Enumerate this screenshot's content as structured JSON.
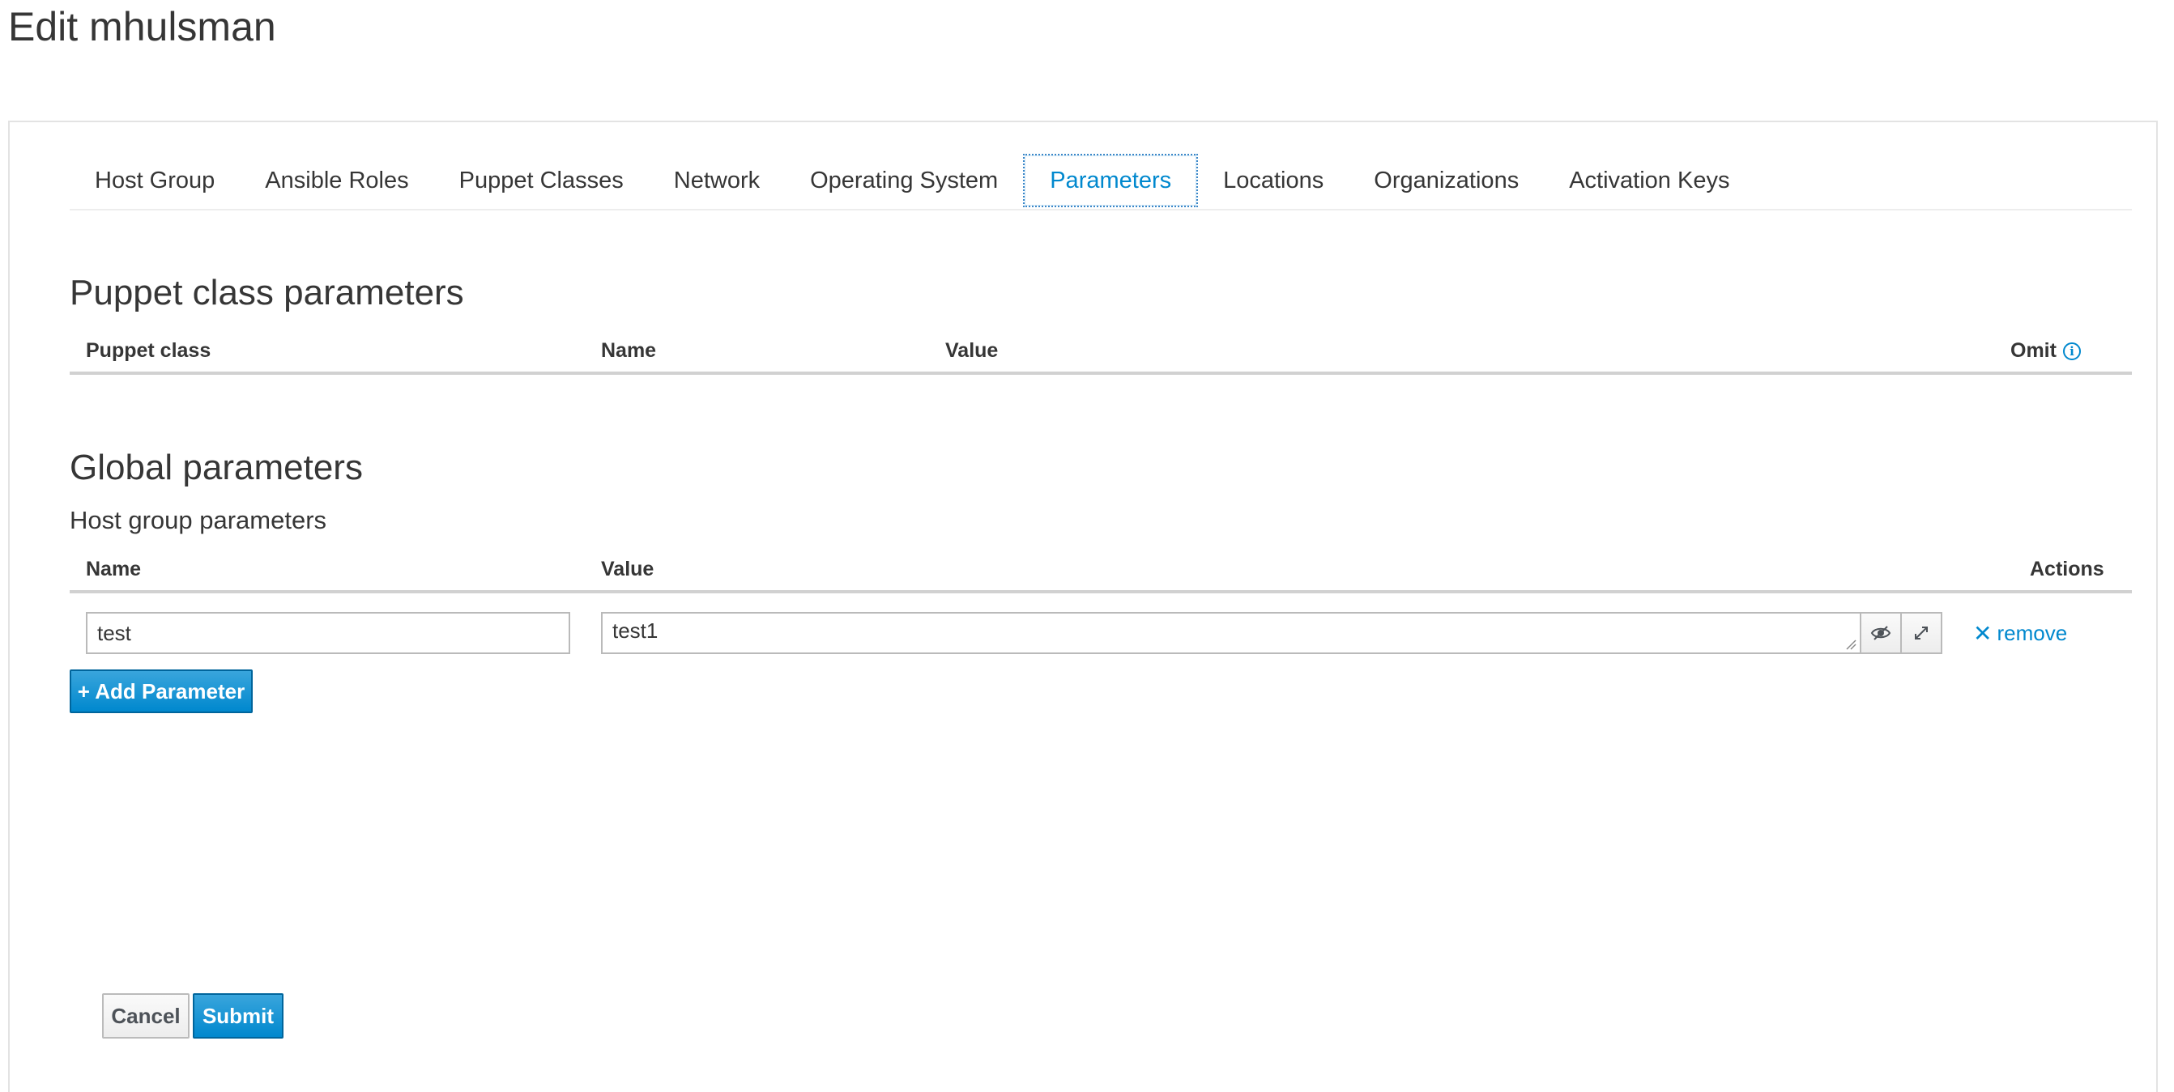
{
  "page": {
    "title": "Edit mhulsman"
  },
  "tabs": [
    {
      "label": "Host Group",
      "active": false
    },
    {
      "label": "Ansible Roles",
      "active": false
    },
    {
      "label": "Puppet Classes",
      "active": false
    },
    {
      "label": "Network",
      "active": false
    },
    {
      "label": "Operating System",
      "active": false
    },
    {
      "label": "Parameters",
      "active": true
    },
    {
      "label": "Locations",
      "active": false
    },
    {
      "label": "Organizations",
      "active": false
    },
    {
      "label": "Activation Keys",
      "active": false
    }
  ],
  "puppet_params": {
    "title": "Puppet class parameters",
    "columns": {
      "puppet_class": "Puppet class",
      "name": "Name",
      "value": "Value",
      "omit": "Omit"
    }
  },
  "global_params": {
    "title": "Global parameters",
    "subtitle": "Host group parameters",
    "columns": {
      "name": "Name",
      "value": "Value",
      "actions": "Actions"
    },
    "rows": [
      {
        "name": "test",
        "value": "test1",
        "remove_label": "remove"
      }
    ],
    "add_button": "+ Add Parameter"
  },
  "form": {
    "cancel_label": "Cancel",
    "submit_label": "Submit"
  },
  "colors": {
    "accent": "#0088ce",
    "text": "#363636",
    "border": "#bababa"
  }
}
